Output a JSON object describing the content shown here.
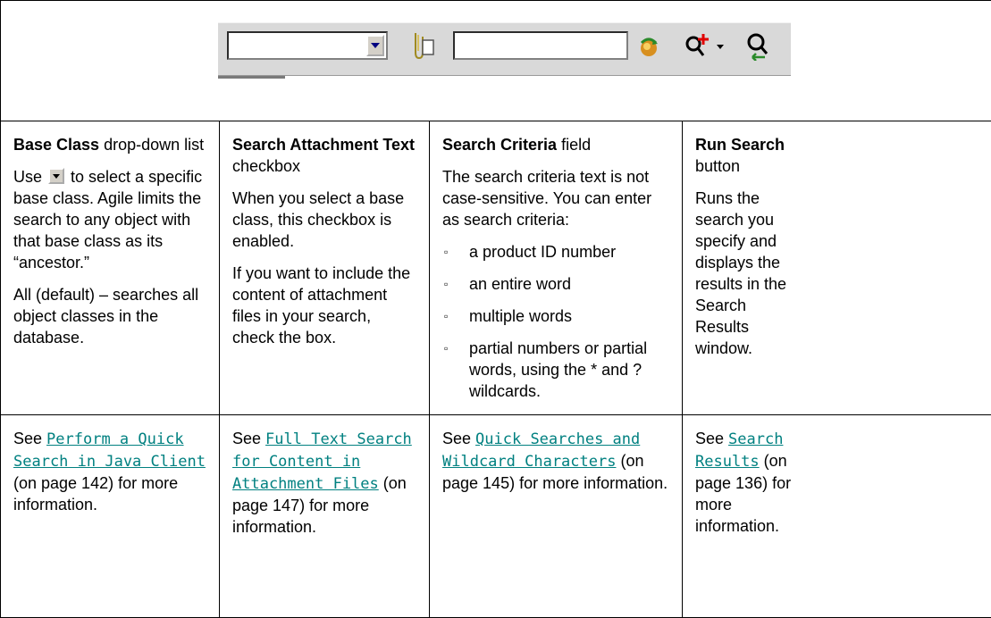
{
  "columns": [
    {
      "heading_bold": "Base Class",
      "heading_rest": " drop-down list",
      "para1_pre": "Use ",
      "para1_post": " to select a specific base class. Agile limits the search to any object with that base class as its “ancestor.”",
      "para2": "All (default) – searches all object classes in the database.",
      "see_pre": "See ",
      "link": "Perform a Quick Search in Java Client",
      "see_post": " (on page 142) for more information."
    },
    {
      "heading_bold": "Search Attachment Text",
      "heading_rest": " checkbox",
      "para1": "When you select a base class, this checkbox is enabled.",
      "para2": "If you want to include the content of attachment files in your search, check the box.",
      "see_pre": "See ",
      "link": "Full Text Search for Content in Attachment Files",
      "see_post": " (on page 147) for more information."
    },
    {
      "heading_bold": "Search Criteria",
      "heading_rest": " field",
      "para1": "The search criteria text is not case-sensitive. You can enter as search criteria:",
      "bullets": [
        "a product ID number",
        "an entire word",
        "multiple words",
        "partial numbers or partial words, using the * and ? wildcards."
      ],
      "see_pre": "See ",
      "link": "Quick Searches and Wildcard Characters",
      "see_post": " (on page 145) for more information."
    },
    {
      "heading_bold": "Run Search",
      "heading_rest": " button",
      "para1": "Runs the search you specify and displays the results in the Search Results window.",
      "see_pre": "See ",
      "link": "Search Results",
      "see_post": " (on page 136) for more information."
    }
  ],
  "bullet_glyph": "▫"
}
